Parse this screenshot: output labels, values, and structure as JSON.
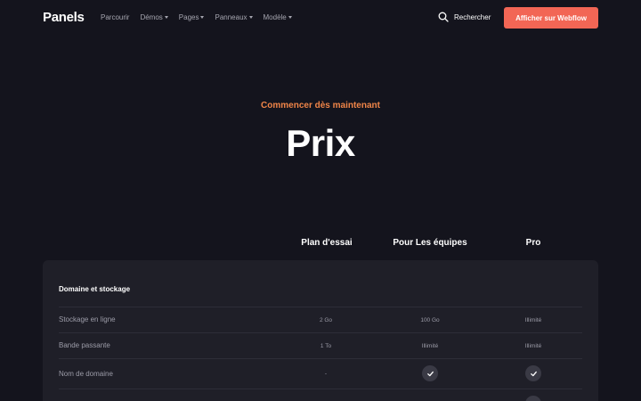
{
  "nav": {
    "logo": "Panels",
    "menu": [
      {
        "label": "Parcourir",
        "dropdown": false
      },
      {
        "label": "Démos",
        "dropdown": true
      },
      {
        "label": "Pages",
        "dropdown": true
      },
      {
        "label": "Panneaux",
        "dropdown": true
      },
      {
        "label": "Modèle",
        "dropdown": true
      }
    ],
    "search_label": "Rechercher",
    "cta_label": "Afficher sur Webflow",
    "search_icon": "search-icon"
  },
  "hero": {
    "eyebrow": "Commencer dès maintenant",
    "title": "Prix"
  },
  "plans": [
    "Plan d'essai",
    "Pour Les équipes",
    "Pro"
  ],
  "table": {
    "section_title": "Domaine et stockage",
    "rows": [
      {
        "label": "Stockage en ligne",
        "values": [
          "2 Go",
          "100 Go",
          "Illimité"
        ]
      },
      {
        "label": "Bande passante",
        "values": [
          "1 To",
          "Illimité",
          "Illimité"
        ]
      },
      {
        "label": "Nom de domaine",
        "values": [
          "-",
          "check",
          "check"
        ]
      }
    ]
  },
  "colors": {
    "background": "#14141d",
    "card": "#1f1f28",
    "accent": "#f26655",
    "eyebrow": "#f08548"
  }
}
